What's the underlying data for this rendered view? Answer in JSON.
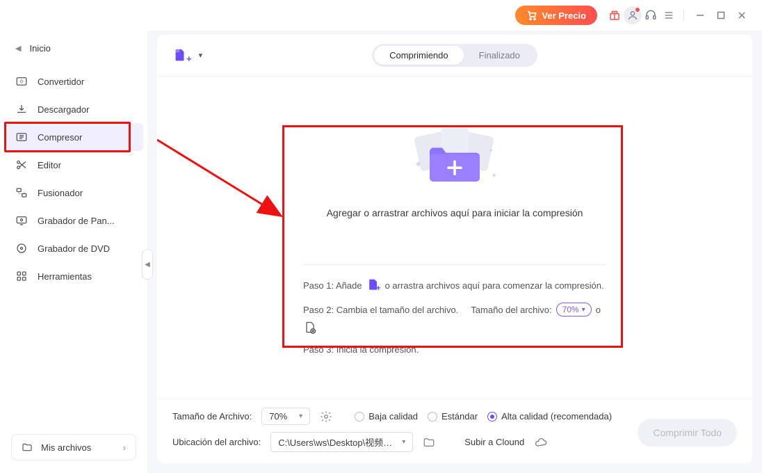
{
  "titlebar": {
    "price_label": "Ver Precio"
  },
  "sidebar": {
    "home": "Inicio",
    "items": [
      {
        "label": "Convertidor"
      },
      {
        "label": "Descargador"
      },
      {
        "label": "Compresor",
        "active": true
      },
      {
        "label": "Editor"
      },
      {
        "label": "Fusionador"
      },
      {
        "label": "Grabador de Pan..."
      },
      {
        "label": "Grabador de DVD"
      },
      {
        "label": "Herramientas"
      }
    ],
    "my_files": "Mis archivos"
  },
  "tabs": {
    "compressing": "Comprimiendo",
    "finished": "Finalizado"
  },
  "drop": {
    "text": "Agregar o arrastrar archivos aquí para iniciar la compresión"
  },
  "steps": {
    "s1a": "Paso 1: Añade",
    "s1b": "o arrastra archivos aquí para comenzar la compresión.",
    "s2a": "Paso 2: Cambia el tamaño del archivo.",
    "s2b": "Tamaño del archivo:",
    "s2_pct": "70%",
    "s2_or": "o",
    "s3": "Paso 3: Inicia la compresión."
  },
  "bottom": {
    "size_label": "Tamaño de Archivo:",
    "size_value": "70%",
    "q_low": "Baja calidad",
    "q_std": "Estándar",
    "q_high": "Alta calidad (recomendada)",
    "loc_label": "Ubicación del archivo:",
    "loc_value": "C:\\Users\\ws\\Desktop\\视频图片",
    "cloud": "Subir a Clound",
    "compress_btn": "Comprimir Todo"
  }
}
